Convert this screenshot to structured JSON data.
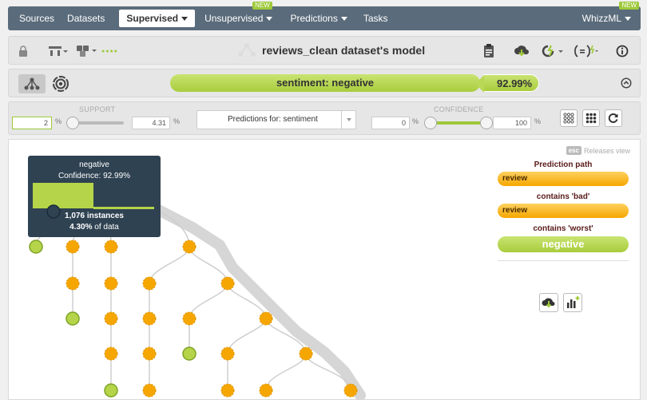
{
  "topnav": {
    "items": [
      {
        "label": "Sources"
      },
      {
        "label": "Datasets"
      },
      {
        "label": "Supervised"
      },
      {
        "label": "Unsupervised",
        "badge": "NEW"
      },
      {
        "label": "Predictions"
      },
      {
        "label": "Tasks"
      }
    ],
    "user_menu": {
      "label": "WhizzML",
      "badge": "NEW"
    }
  },
  "toolbar": {
    "title": "reviews_clean dataset's model",
    "icons": [
      "lock-icon",
      "tree-icon",
      "fields-icon",
      "dots-icon",
      "report-icon",
      "download-icon",
      "actions-icon",
      "formula-icon",
      "info-icon"
    ],
    "dots_label": "●●●●"
  },
  "prediction": {
    "label": "sentiment: negative",
    "confidence": "92.99%"
  },
  "filters": {
    "support_label": "SUPPORT",
    "support_min": "2",
    "support_max": "4.31",
    "support_slider_fraction": 0.0,
    "select_label": "Predictions for: sentiment",
    "confidence_label": "CONFIDENCE",
    "confidence_min": "0",
    "confidence_max": "100",
    "confidence_slider_fraction": 1.0,
    "pct": "%"
  },
  "tooltip": {
    "class_name": "negative",
    "confidence": "Confidence: 92.99%",
    "instances": "1,076 instances",
    "data_share_value": "4.30%",
    "data_share_suffix": "of data"
  },
  "hint": {
    "key": "esc",
    "text": "Releases view"
  },
  "path_panel": {
    "title": "Prediction path",
    "steps": [
      {
        "field": "review",
        "condition": "contains 'bad'"
      },
      {
        "field": "review",
        "condition": "contains 'worst'"
      }
    ],
    "result": "negative"
  },
  "colors": {
    "accent_green": "#a9cc3c",
    "node_orange": "#f6a600",
    "nav_bg": "#5a6b7b",
    "tooltip_bg": "#2f4252"
  }
}
